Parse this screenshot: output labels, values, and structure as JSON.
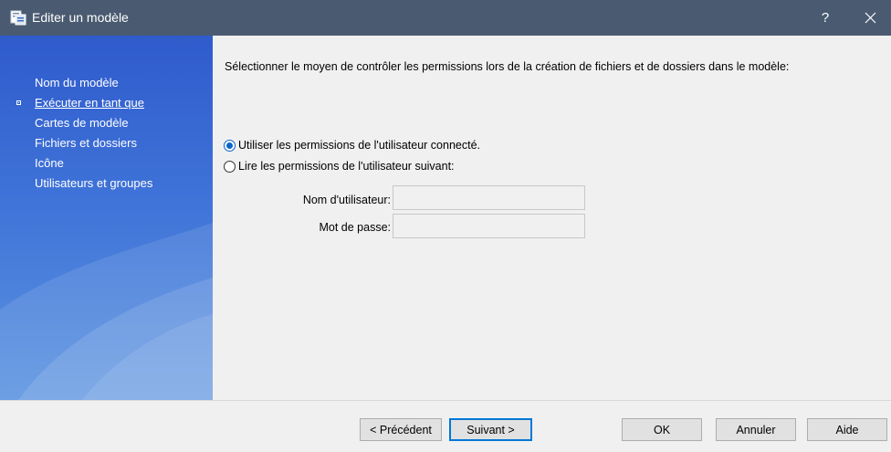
{
  "window": {
    "title": "Editer un modèle",
    "help_label": "?",
    "app_icon": "template-icon",
    "close_icon": "close-icon"
  },
  "sidebar": {
    "items": [
      {
        "label": "Nom du modèle",
        "active": false
      },
      {
        "label": "Exécuter en tant que",
        "active": true
      },
      {
        "label": "Cartes de modèle",
        "active": false
      },
      {
        "label": "Fichiers et dossiers",
        "active": false
      },
      {
        "label": "Icône",
        "active": false
      },
      {
        "label": "Utilisateurs et groupes",
        "active": false
      }
    ]
  },
  "main": {
    "instruction": "Sélectionner le moyen de contrôler les permissions lors de la création de fichiers et de dossiers dans le modèle:",
    "options": [
      {
        "label": "Utiliser les permissions de l'utilisateur connecté.",
        "checked": true
      },
      {
        "label": "Lire les permissions de l'utilisateur suivant:",
        "checked": false
      }
    ],
    "username_label": "Nom d'utilisateur:",
    "username_value": "",
    "password_label": "Mot de passe:",
    "password_value": ""
  },
  "buttons": {
    "previous": "< Précédent",
    "next": "Suivant >",
    "ok": "OK",
    "cancel": "Annuler",
    "help": "Aide"
  },
  "colors": {
    "titlebar": "#4a5a70",
    "sidebar": "#3f73d8",
    "accent": "#0078d7"
  }
}
